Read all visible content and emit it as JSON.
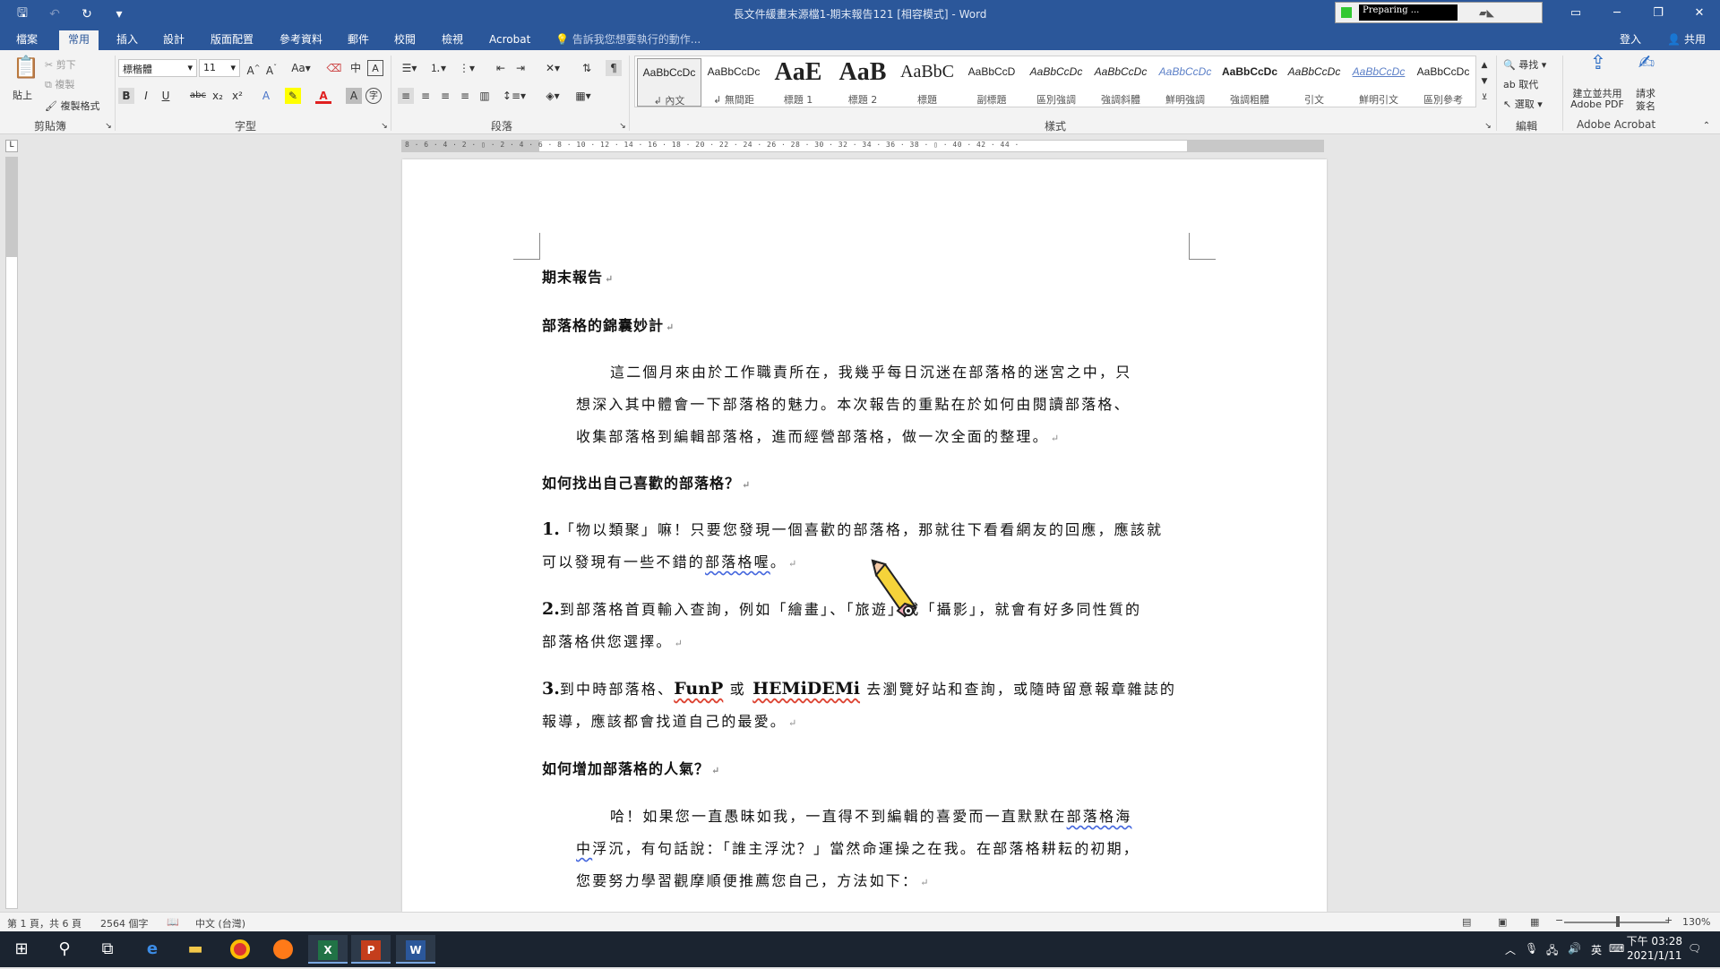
{
  "window": {
    "title": "長文件緩畫末源檔1-期末報告121 [相容模式] - Word",
    "preparing_text": "Preparing ..."
  },
  "qat": {
    "save": "🖫",
    "undo": "↶",
    "redo": "↻",
    "customize": "▾"
  },
  "tabs": [
    "檔案",
    "常用",
    "插入",
    "設計",
    "版面配置",
    "參考資料",
    "郵件",
    "校閱",
    "檢視",
    "Acrobat"
  ],
  "tell_me": "告訴我您想要執行的動作...",
  "signin": "登入",
  "share": "共用",
  "ribbon": {
    "clipboard": {
      "paste": "貼上",
      "cut": "剪下",
      "copy": "複製",
      "format_painter": "複製格式",
      "label": "剪貼簿"
    },
    "font": {
      "name": "標楷體",
      "size": "11",
      "label": "字型"
    },
    "paragraph": {
      "label": "段落"
    },
    "styles": {
      "label": "樣式",
      "items": [
        {
          "preview": "AaBbCcDc",
          "name": "↲ 內文"
        },
        {
          "preview": "AaBbCcDc",
          "name": "↲ 無間距"
        },
        {
          "preview": "AaE",
          "name": "標題 1"
        },
        {
          "preview": "AaB",
          "name": "標題 2"
        },
        {
          "preview": "AaBbC",
          "name": "標題"
        },
        {
          "preview": "AaBbCcD",
          "name": "副標題"
        },
        {
          "preview": "AaBbCcDc",
          "name": "區別強調"
        },
        {
          "preview": "AaBbCcDc",
          "name": "強調斜體"
        },
        {
          "preview": "AaBbCcDc",
          "name": "鮮明強調"
        },
        {
          "preview": "AaBbCcDc",
          "name": "強調粗體"
        },
        {
          "preview": "AaBbCcDc",
          "name": "引文"
        },
        {
          "preview": "AaBbCcDc",
          "name": "鮮明引文"
        },
        {
          "preview": "AaBbCcDc",
          "name": "區別參考"
        }
      ]
    },
    "editing": {
      "find": "尋找",
      "replace": "取代",
      "select": "選取",
      "label": "編輯"
    },
    "acrobat": {
      "create_share": "建立並共用",
      "adobe_pdf": "Adobe PDF",
      "request": "請求",
      "sign": "簽名",
      "label": "Adobe Acrobat"
    }
  },
  "ruler": {
    "h_ticks": "8 · 6 · 4 · 2 · ▯ · 2 · 4 · 6 · 8 · 10 · 12 · 14 · 16 · 18 · 20 · 22 · 24 · 26 · 28 · 30 · 32 · 34 · 36 · 38 · ▯ · 40 · 42 · 44 ·",
    "corner": "L"
  },
  "document": {
    "title": "期末報告",
    "subtitle": "部落格的錦囊妙計",
    "intro": [
      "這二個月來由於工作職責所在，我幾乎每日沉迷在部落格的迷宮之中，只",
      "想深入其中體會一下部落格的魅力。本次報告的重點在於如何由閱讀部落格、",
      "收集部落格到編輯部落格，進而經營部落格，做一次全面的整理。"
    ],
    "h2": "如何找出自己喜歡的部落格？",
    "item1": {
      "num": "1.",
      "line1": "「物以類聚」嘛！只要您發現一個喜歡的部落格，那就往下看看網友的回應，應該就",
      "line2a": "可以發現有一些不錯的",
      "line2b": "部落格喔",
      "line2c": "。"
    },
    "item2": {
      "num": "2.",
      "line1": "到部落格首頁輸入查詢，例如「繪畫」、「旅遊」或「攝影」，就會有好多同性質的",
      "line2": "部落格供您選擇。"
    },
    "item3": {
      "num": "3.",
      "pre": "到中時部落格、",
      "brand1": "FunP",
      "mid": " 或 ",
      "brand2": "HEMiDEMi",
      "post": " 去瀏覽好站和查詢，或隨時留意報章雜誌的",
      "line2": "報導，應該都會找道自己的最愛。"
    },
    "h3": "如何增加部落格的人氣？",
    "outro": {
      "line1a": "哈！如果您一直愚昧如我，一直得不到編輯的喜愛而一直默默在",
      "line1b": "部落格海",
      "line2a": "中",
      "line2b": "浮沉，有句話說：「誰主浮沈？」當然命運操之在我。在部落格耕耘的初期，",
      "line3": "您要努力學習觀摩順便推薦您自己，方法如下："
    },
    "para_mark": "↵"
  },
  "status": {
    "page": "第 1 頁，共 6 頁",
    "words": "2564 個字",
    "lang": "中文 (台灣)",
    "zoom": "130%",
    "zoom_level": 0.52
  },
  "taskbar": {
    "time": "下午 03:28",
    "date": "2021/1/11",
    "ime": "英"
  },
  "colors": {
    "accent": "#2b579a",
    "taskbar": "#1b2430",
    "spell": "#dd4433",
    "grammar": "#4466dd"
  }
}
